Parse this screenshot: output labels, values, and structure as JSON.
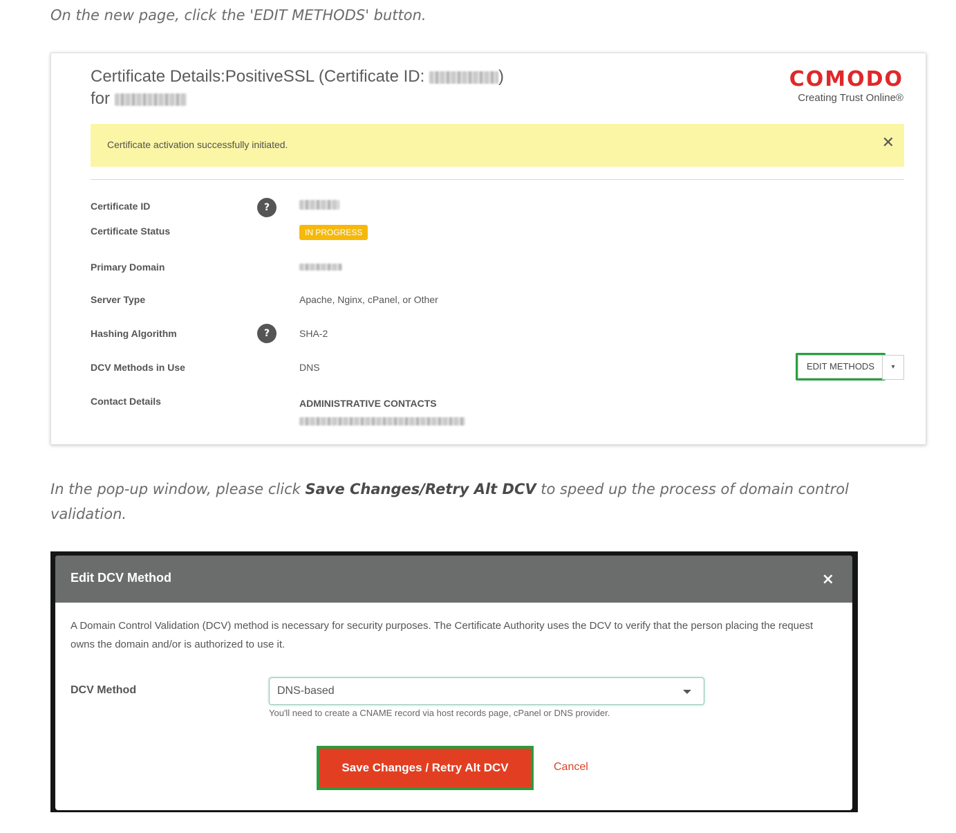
{
  "instructions": {
    "step1": "On the new page, click the 'EDIT METHODS' button.",
    "step2_prefix": "In the pop-up window, please click ",
    "step2_bold": "Save Changes/Retry Alt DCV",
    "step2_suffix": " to speed up the process of domain control validation."
  },
  "certificate_page": {
    "title_prefix": "Certificate Details:PositiveSSL (Certificate ID: ",
    "title_suffix": ")",
    "for_label": "for",
    "logo": {
      "name": "COMODO",
      "tagline": "Creating Trust Online®",
      "color": "#e0282a"
    },
    "alert": {
      "message": "Certificate activation successfully initiated.",
      "close_icon": "close-icon"
    },
    "fields": {
      "certificate_id_label": "Certificate ID",
      "certificate_status_label": "Certificate Status",
      "certificate_status_value": "IN PROGRESS",
      "primary_domain_label": "Primary Domain",
      "server_type_label": "Server Type",
      "server_type_value": "Apache, Nginx, cPanel, or Other",
      "hashing_label": "Hashing Algorithm",
      "hashing_value": "SHA-2",
      "dcv_label": "DCV Methods in Use",
      "dcv_value": "DNS",
      "contact_label": "Contact Details",
      "contacts_heading": "ADMINISTRATIVE CONTACTS"
    },
    "help_glyph": "?",
    "edit_methods_button": "EDIT METHODS",
    "dropdown_caret": "▾",
    "status_color": "#f6b90b",
    "highlight_color": "#27a140"
  },
  "dcv_modal": {
    "title": "Edit DCV Method",
    "close_glyph": "×",
    "description": "A Domain Control Validation (DCV) method is necessary for security purposes. The Certificate Authority uses the DCV to verify that the person placing the request owns the domain and/or is authorized to use it.",
    "dcv_method_label": "DCV Method",
    "dcv_method_value": "DNS-based",
    "hint": "You'll need to create a CNAME record via host records page, cPanel or DNS provider.",
    "save_button": "Save Changes / Retry Alt DCV",
    "cancel_link": "Cancel",
    "save_color": "#e23f22"
  }
}
